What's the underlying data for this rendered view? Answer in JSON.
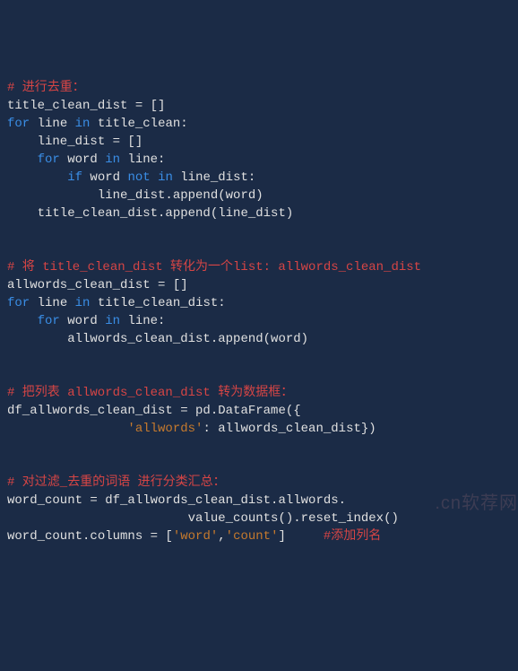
{
  "code": {
    "line1_comment": "# 进行去重：",
    "line2": "title_clean_dist = []",
    "line3_for": "for",
    "line3_mid": " line ",
    "line3_in": "in",
    "line3_end": " title_clean:",
    "line4": "    line_dist = []",
    "line5_for": "    for",
    "line5_mid": " word ",
    "line5_in": "in",
    "line5_end": " line:",
    "line6_if": "        if",
    "line6_mid": " word ",
    "line6_not": "not",
    "line6_sp": " ",
    "line6_in": "in",
    "line6_end": " line_dist:",
    "line7": "            line_dist.append(word)",
    "line8": "    title_clean_dist.append(line_dist)",
    "line10_comment": "# 将 title_clean_dist 转化为一个list: allwords_clean_dist",
    "line11": "allwords_clean_dist = []",
    "line12_for": "for",
    "line12_mid": " line ",
    "line12_in": "in",
    "line12_end": " title_clean_dist:",
    "line13_for": "    for",
    "line13_mid": " word ",
    "line13_in": "in",
    "line13_end": " line:",
    "line14": "        allwords_clean_dist.append(word)",
    "line16_comment": "# 把列表 allwords_clean_dist 转为数据框：",
    "line17": "df_allwords_clean_dist = pd.DataFrame({",
    "line18_indent": "                ",
    "line18_str": "'allwords'",
    "line18_rest": ": allwords_clean_dist})",
    "line20_comment": "# 对过滤_去重的词语 进行分类汇总：",
    "line21": "word_count = df_allwords_clean_dist.allwords.",
    "line22_indent": "                        ",
    "line22_rest": "value_counts().reset_index()",
    "line23_a": "word_count.columns = [",
    "line23_s1": "'word'",
    "line23_comma": ",",
    "line23_s2": "'count'",
    "line23_b": "]",
    "line23_pad": "     ",
    "line23_comment": "#添加列名"
  },
  "watermark": ".cn软荐网"
}
